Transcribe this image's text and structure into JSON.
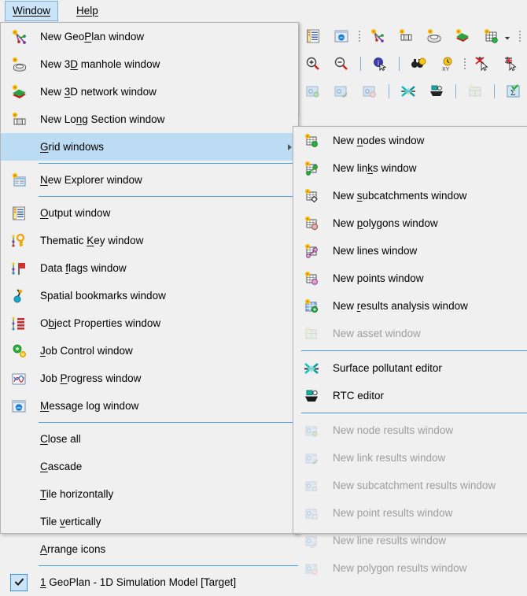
{
  "menubar": {
    "items": [
      {
        "label": "Window",
        "accel": "W",
        "active": true,
        "name": "menubar-window"
      },
      {
        "label": "Help",
        "accel": "H",
        "active": false,
        "name": "menubar-help"
      }
    ]
  },
  "toolbars": {
    "row1": [
      "output-window-icon",
      "message-log-window-icon",
      "dots-separator",
      "new-geoplan-window-icon",
      "new-long-section-window-icon",
      "new-3d-manhole-window-icon",
      "new-3d-network-window-icon",
      "new-grid-window-icon",
      "dropdown-caret",
      "dots-separator"
    ],
    "row2": [
      "zoom-in-icon",
      "zoom-out-icon",
      "bar-separator",
      "select-info-icon",
      "bar-separator",
      "find-binoculars-icon",
      "find-xy-icon",
      "dots-separator",
      "deselect-icon",
      "invert-selection-icon",
      "select-by-attribute-icon"
    ],
    "row3": [
      "node-results-icon",
      "link-results-icon",
      "subcatchment-results-icon",
      "bar-separator",
      "surface-pollutant-editor-icon",
      "rtc-editor-icon",
      "bar-separator",
      "asset-window-icon",
      "bar-separator",
      "sum-statistics-icon",
      "dots-separator",
      "partial-icon"
    ]
  },
  "window_menu": {
    "name": "window-menu",
    "items": [
      {
        "type": "item",
        "label": "New GeoPlan window",
        "accel": "P",
        "icon": "new-geoplan-window-icon",
        "enabled": true
      },
      {
        "type": "item",
        "label": "New 3D manhole window",
        "accel": "D",
        "icon": "new-3d-manhole-window-icon",
        "enabled": true
      },
      {
        "type": "item",
        "label": "New 3D network window",
        "accel": "3",
        "icon": "new-3d-network-window-icon",
        "enabled": true
      },
      {
        "type": "item",
        "label": "New Long Section window",
        "accel": "n",
        "icon": "new-long-section-window-icon",
        "enabled": true
      },
      {
        "type": "item",
        "label": "Grid windows",
        "accel": "G",
        "icon": "none",
        "enabled": true,
        "highlighted": true,
        "submenu": true
      },
      {
        "type": "separator"
      },
      {
        "type": "item",
        "label": "New Explorer window",
        "accel": "N",
        "icon": "new-explorer-window-icon",
        "enabled": true
      },
      {
        "type": "separator"
      },
      {
        "type": "item",
        "label": "Output window",
        "accel": "O",
        "icon": "output-window-icon",
        "enabled": true
      },
      {
        "type": "item",
        "label": "Thematic Key window",
        "accel": "K",
        "icon": "thematic-key-window-icon",
        "enabled": true
      },
      {
        "type": "item",
        "label": "Data flags window",
        "accel": "f",
        "icon": "data-flags-window-icon",
        "enabled": true
      },
      {
        "type": "item",
        "label": "Spatial bookmarks window",
        "accel": "S",
        "icon": "spatial-bookmarks-window-icon",
        "enabled": true
      },
      {
        "type": "item",
        "label": "Object Properties window",
        "accel": "b",
        "icon": "object-properties-window-icon",
        "enabled": true
      },
      {
        "type": "item",
        "label": "Job Control window",
        "accel": "J",
        "icon": "job-control-window-icon",
        "enabled": true
      },
      {
        "type": "item",
        "label": "Job Progress window",
        "accel": "P",
        "icon": "job-progress-window-icon",
        "enabled": true
      },
      {
        "type": "item",
        "label": "Message log window",
        "accel": "M",
        "icon": "message-log-window-icon",
        "enabled": true
      },
      {
        "type": "separator"
      },
      {
        "type": "item",
        "label": "Close all",
        "accel": "C",
        "icon": "none",
        "enabled": true
      },
      {
        "type": "item",
        "label": "Cascade",
        "accel": "C",
        "icon": "none",
        "enabled": true
      },
      {
        "type": "item",
        "label": "Tile horizontally",
        "accel": "T",
        "icon": "none",
        "enabled": true
      },
      {
        "type": "item",
        "label": "Tile vertically",
        "accel": "v",
        "icon": "none",
        "enabled": true
      },
      {
        "type": "item",
        "label": "Arrange icons",
        "accel": "A",
        "icon": "none",
        "enabled": true
      },
      {
        "type": "separator"
      },
      {
        "type": "item",
        "label": "1 GeoPlan - 1D Simulation Model [Target]",
        "accel": "1",
        "icon": "checkmark-icon",
        "enabled": true,
        "checked": true
      }
    ]
  },
  "grid_submenu": {
    "name": "grid-windows-submenu",
    "items": [
      {
        "type": "item",
        "label": "New nodes window",
        "accel": "n",
        "icon": "new-nodes-window-icon",
        "enabled": true
      },
      {
        "type": "item",
        "label": "New links window",
        "accel": "k",
        "icon": "new-links-window-icon",
        "enabled": true
      },
      {
        "type": "item",
        "label": "New subcatchments window",
        "accel": "s",
        "icon": "new-subcatchments-window-icon",
        "enabled": true
      },
      {
        "type": "item",
        "label": "New polygons window",
        "accel": "p",
        "icon": "new-polygons-window-icon",
        "enabled": true
      },
      {
        "type": "item",
        "label": "New lines window",
        "accel": "",
        "icon": "new-lines-window-icon",
        "enabled": true
      },
      {
        "type": "item",
        "label": "New points window",
        "accel": "",
        "icon": "new-points-window-icon",
        "enabled": true
      },
      {
        "type": "item",
        "label": "New results analysis window",
        "accel": "r",
        "icon": "new-results-analysis-window-icon",
        "enabled": true
      },
      {
        "type": "item",
        "label": "New asset window",
        "accel": "",
        "icon": "new-asset-window-icon",
        "enabled": false
      },
      {
        "type": "separator"
      },
      {
        "type": "item",
        "label": "Surface pollutant editor",
        "accel": "",
        "icon": "surface-pollutant-editor-icon",
        "enabled": true
      },
      {
        "type": "item",
        "label": "RTC editor",
        "accel": "",
        "icon": "rtc-editor-icon",
        "enabled": true
      },
      {
        "type": "separator"
      },
      {
        "type": "item",
        "label": "New node results window",
        "accel": "",
        "icon": "new-node-results-window-icon",
        "enabled": false
      },
      {
        "type": "item",
        "label": "New link results window",
        "accel": "",
        "icon": "new-link-results-window-icon",
        "enabled": false
      },
      {
        "type": "item",
        "label": "New subcatchment results window",
        "accel": "",
        "icon": "new-subcatchment-results-window-icon",
        "enabled": false
      },
      {
        "type": "item",
        "label": "New point results window",
        "accel": "",
        "icon": "new-point-results-window-icon",
        "enabled": false
      },
      {
        "type": "item",
        "label": "New line results window",
        "accel": "",
        "icon": "new-line-results-window-icon",
        "enabled": false
      },
      {
        "type": "item",
        "label": "New polygon results window",
        "accel": "",
        "icon": "new-polygon-results-window-icon",
        "enabled": false
      }
    ]
  },
  "colors": {
    "menu_bg": "#f0f0f0",
    "highlight": "#bcdcf4",
    "menubar_active": "#cce4f7",
    "separator": "#4a9fe0",
    "disabled_text": "#9d9d9d",
    "border": "#b4b4b4"
  }
}
